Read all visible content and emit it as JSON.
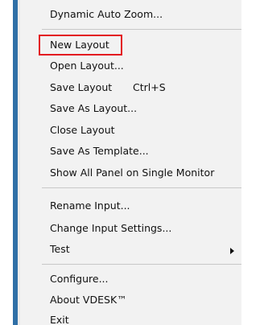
{
  "menu": {
    "items": [
      {
        "label": "Dynamic Auto Zoom..."
      },
      {
        "label": "New Layout"
      },
      {
        "label": "Open Layout..."
      },
      {
        "label": "Save Layout",
        "shortcut": "Ctrl+S"
      },
      {
        "label": "Save As Layout..."
      },
      {
        "label": "Close Layout"
      },
      {
        "label": "Save As Template..."
      },
      {
        "label": "Show All Panel on Single Monitor"
      },
      {
        "label": "Rename Input..."
      },
      {
        "label": "Change Input Settings..."
      },
      {
        "label": "Test"
      },
      {
        "label": "Configure..."
      },
      {
        "label": "About VDESK™"
      },
      {
        "label": "Exit"
      }
    ]
  },
  "colors": {
    "menu_background": "#f2f2f2",
    "highlight_border": "#e3161f",
    "accent_bar": "#2f6fa6"
  },
  "icons": {
    "submenu_arrow": "chevron-right-icon"
  }
}
